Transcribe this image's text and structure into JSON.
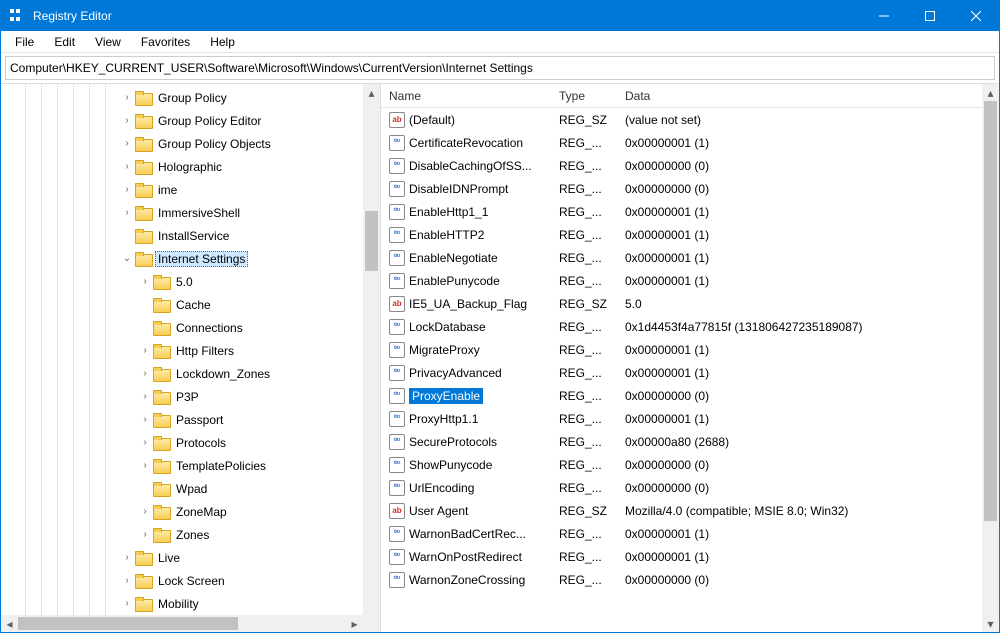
{
  "window": {
    "title": "Registry Editor"
  },
  "menu": {
    "file": "File",
    "edit": "Edit",
    "view": "View",
    "favorites": "Favorites",
    "help": "Help"
  },
  "address": "Computer\\HKEY_CURRENT_USER\\Software\\Microsoft\\Windows\\CurrentVersion\\Internet Settings",
  "tree": {
    "items": [
      {
        "level": 6,
        "exp": ">",
        "label": "Group Policy"
      },
      {
        "level": 6,
        "exp": ">",
        "label": "Group Policy Editor"
      },
      {
        "level": 6,
        "exp": ">",
        "label": "Group Policy Objects"
      },
      {
        "level": 6,
        "exp": ">",
        "label": "Holographic"
      },
      {
        "level": 6,
        "exp": ">",
        "label": "ime"
      },
      {
        "level": 6,
        "exp": ">",
        "label": "ImmersiveShell"
      },
      {
        "level": 6,
        "exp": "",
        "label": "InstallService"
      },
      {
        "level": 6,
        "exp": "v",
        "label": "Internet Settings",
        "selected": true
      },
      {
        "level": 7,
        "exp": ">",
        "label": "5.0"
      },
      {
        "level": 7,
        "exp": "",
        "label": "Cache"
      },
      {
        "level": 7,
        "exp": "",
        "label": "Connections"
      },
      {
        "level": 7,
        "exp": ">",
        "label": "Http Filters"
      },
      {
        "level": 7,
        "exp": ">",
        "label": "Lockdown_Zones"
      },
      {
        "level": 7,
        "exp": ">",
        "label": "P3P"
      },
      {
        "level": 7,
        "exp": ">",
        "label": "Passport"
      },
      {
        "level": 7,
        "exp": ">",
        "label": "Protocols"
      },
      {
        "level": 7,
        "exp": ">",
        "label": "TemplatePolicies"
      },
      {
        "level": 7,
        "exp": "",
        "label": "Wpad"
      },
      {
        "level": 7,
        "exp": ">",
        "label": "ZoneMap"
      },
      {
        "level": 7,
        "exp": ">",
        "label": "Zones"
      },
      {
        "level": 6,
        "exp": ">",
        "label": "Live"
      },
      {
        "level": 6,
        "exp": ">",
        "label": "Lock Screen"
      },
      {
        "level": 6,
        "exp": ">",
        "label": "Mobility"
      }
    ]
  },
  "list": {
    "headers": {
      "name": "Name",
      "type": "Type",
      "data": "Data"
    },
    "rows": [
      {
        "icon": "sz",
        "name": "(Default)",
        "type": "REG_SZ",
        "data": "(value not set)"
      },
      {
        "icon": "bin",
        "name": "CertificateRevocation",
        "type": "REG_...",
        "data": "0x00000001 (1)"
      },
      {
        "icon": "bin",
        "name": "DisableCachingOfSS...",
        "type": "REG_...",
        "data": "0x00000000 (0)"
      },
      {
        "icon": "bin",
        "name": "DisableIDNPrompt",
        "type": "REG_...",
        "data": "0x00000000 (0)"
      },
      {
        "icon": "bin",
        "name": "EnableHttp1_1",
        "type": "REG_...",
        "data": "0x00000001 (1)"
      },
      {
        "icon": "bin",
        "name": "EnableHTTP2",
        "type": "REG_...",
        "data": "0x00000001 (1)"
      },
      {
        "icon": "bin",
        "name": "EnableNegotiate",
        "type": "REG_...",
        "data": "0x00000001 (1)"
      },
      {
        "icon": "bin",
        "name": "EnablePunycode",
        "type": "REG_...",
        "data": "0x00000001 (1)"
      },
      {
        "icon": "sz",
        "name": "IE5_UA_Backup_Flag",
        "type": "REG_SZ",
        "data": "5.0"
      },
      {
        "icon": "bin",
        "name": "LockDatabase",
        "type": "REG_...",
        "data": "0x1d4453f4a77815f (131806427235189087)"
      },
      {
        "icon": "bin",
        "name": "MigrateProxy",
        "type": "REG_...",
        "data": "0x00000001 (1)"
      },
      {
        "icon": "bin",
        "name": "PrivacyAdvanced",
        "type": "REG_...",
        "data": "0x00000001 (1)"
      },
      {
        "icon": "bin",
        "name": "ProxyEnable",
        "type": "REG_...",
        "data": "0x00000000 (0)",
        "selected": true
      },
      {
        "icon": "bin",
        "name": "ProxyHttp1.1",
        "type": "REG_...",
        "data": "0x00000001 (1)"
      },
      {
        "icon": "bin",
        "name": "SecureProtocols",
        "type": "REG_...",
        "data": "0x00000a80 (2688)"
      },
      {
        "icon": "bin",
        "name": "ShowPunycode",
        "type": "REG_...",
        "data": "0x00000000 (0)"
      },
      {
        "icon": "bin",
        "name": "UrlEncoding",
        "type": "REG_...",
        "data": "0x00000000 (0)"
      },
      {
        "icon": "sz",
        "name": "User Agent",
        "type": "REG_SZ",
        "data": "Mozilla/4.0 (compatible; MSIE 8.0; Win32)"
      },
      {
        "icon": "bin",
        "name": "WarnonBadCertRec...",
        "type": "REG_...",
        "data": "0x00000001 (1)"
      },
      {
        "icon": "bin",
        "name": "WarnOnPostRedirect",
        "type": "REG_...",
        "data": "0x00000001 (1)"
      },
      {
        "icon": "bin",
        "name": "WarnonZoneCrossing",
        "type": "REG_...",
        "data": "0x00000000 (0)"
      }
    ]
  },
  "icon_text": {
    "sz": "ab",
    "bin": "011\n110"
  }
}
